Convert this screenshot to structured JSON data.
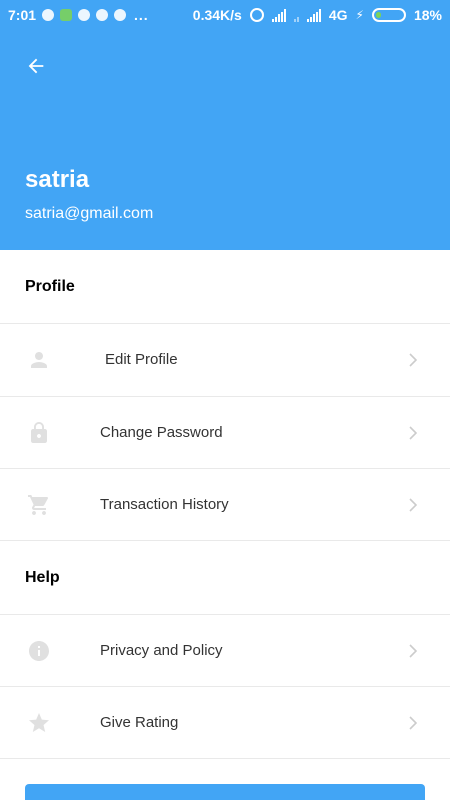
{
  "status_bar": {
    "time": "7:01",
    "more": "...",
    "speed": "0.34K/s",
    "network": "4G",
    "battery_percent": "18%",
    "battery_level": 0.18
  },
  "header": {
    "back_icon": "arrow-back-icon",
    "name": "satria",
    "email": "satria@gmail.com",
    "background_color": "#42A5F5"
  },
  "sections": {
    "profile": {
      "title": "Profile",
      "items": [
        {
          "label": "Edit Profile",
          "icon": "person-icon"
        },
        {
          "label": "Change Password",
          "icon": "lock-icon"
        },
        {
          "label": "Transaction History",
          "icon": "cart-icon"
        }
      ]
    },
    "help": {
      "title": "Help",
      "items": [
        {
          "label": "Privacy and Policy",
          "icon": "info-icon"
        },
        {
          "label": "Give Rating",
          "icon": "star-icon"
        }
      ]
    }
  },
  "colors": {
    "accent": "#42A5F5",
    "icon_muted": "#E0E0E0",
    "chevron": "#CCCCCC"
  }
}
